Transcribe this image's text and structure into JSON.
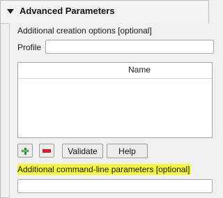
{
  "section": {
    "title": "Advanced Parameters"
  },
  "creation_options": {
    "label": "Additional creation options [optional]",
    "profile_label": "Profile",
    "profile_value": "",
    "table": {
      "columns": [
        "Name"
      ],
      "rows": []
    },
    "buttons": {
      "add_icon": "plus-icon",
      "remove_icon": "minus-icon",
      "validate_label": "Validate",
      "help_label": "Help"
    }
  },
  "command_line": {
    "label": "Additional command-line parameters [optional]",
    "value": ""
  },
  "colors": {
    "highlight": "#f5f543",
    "add_icon": "#2e8b2e",
    "remove_icon": "#d9252e"
  }
}
